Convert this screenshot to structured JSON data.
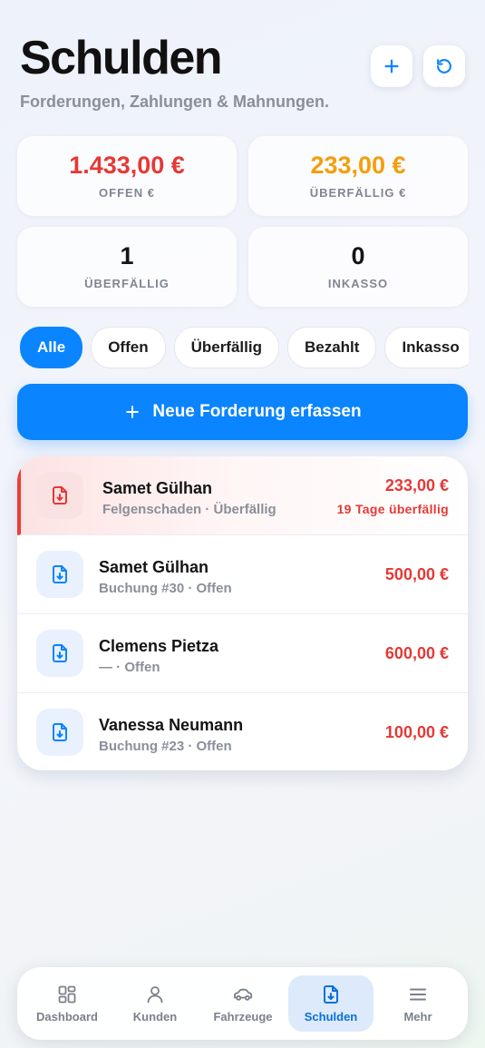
{
  "header": {
    "title": "Schulden",
    "subtitle": "Forderungen, Zahlungen & Mahnungen."
  },
  "actions": {
    "add_icon": "plus-icon",
    "refresh_icon": "refresh-icon"
  },
  "stats": {
    "open_amount": "1.433,00 €",
    "open_amount_label": "OFFEN €",
    "overdue_amount": "233,00 €",
    "overdue_amount_label": "ÜBERFÄLLIG €",
    "overdue_count": "1",
    "overdue_count_label": "ÜBERFÄLLIG",
    "collection_count": "0",
    "collection_count_label": "INKASSO"
  },
  "filters": [
    "Alle",
    "Offen",
    "Überfällig",
    "Bezahlt",
    "Inkasso"
  ],
  "active_filter": "Alle",
  "new_claim_label": "Neue Forderung erfassen",
  "claims": [
    {
      "name": "Samet Gülhan",
      "meta": "Felgenschaden · Überfällig",
      "amount": "233,00 €",
      "overdue_text": "19 Tage überfällig"
    },
    {
      "name": "Samet Gülhan",
      "meta": "Buchung #30 · Offen",
      "amount": "500,00 €"
    },
    {
      "name": "Clemens Pietza",
      "meta": "— · Offen",
      "amount": "600,00 €"
    },
    {
      "name": "Vanessa Neumann",
      "meta": "Buchung #23 · Offen",
      "amount": "100,00 €"
    }
  ],
  "tabbar": {
    "items": [
      {
        "label": "Dashboard",
        "icon": "grid-icon"
      },
      {
        "label": "Kunden",
        "icon": "user-icon"
      },
      {
        "label": "Fahrzeuge",
        "icon": "car-icon"
      },
      {
        "label": "Schulden",
        "icon": "document-icon"
      },
      {
        "label": "Mehr",
        "icon": "menu-icon"
      }
    ],
    "active": "Schulden"
  },
  "colors": {
    "accent": "#0a84ff",
    "danger": "#e53935",
    "warning": "#f59e0b"
  }
}
